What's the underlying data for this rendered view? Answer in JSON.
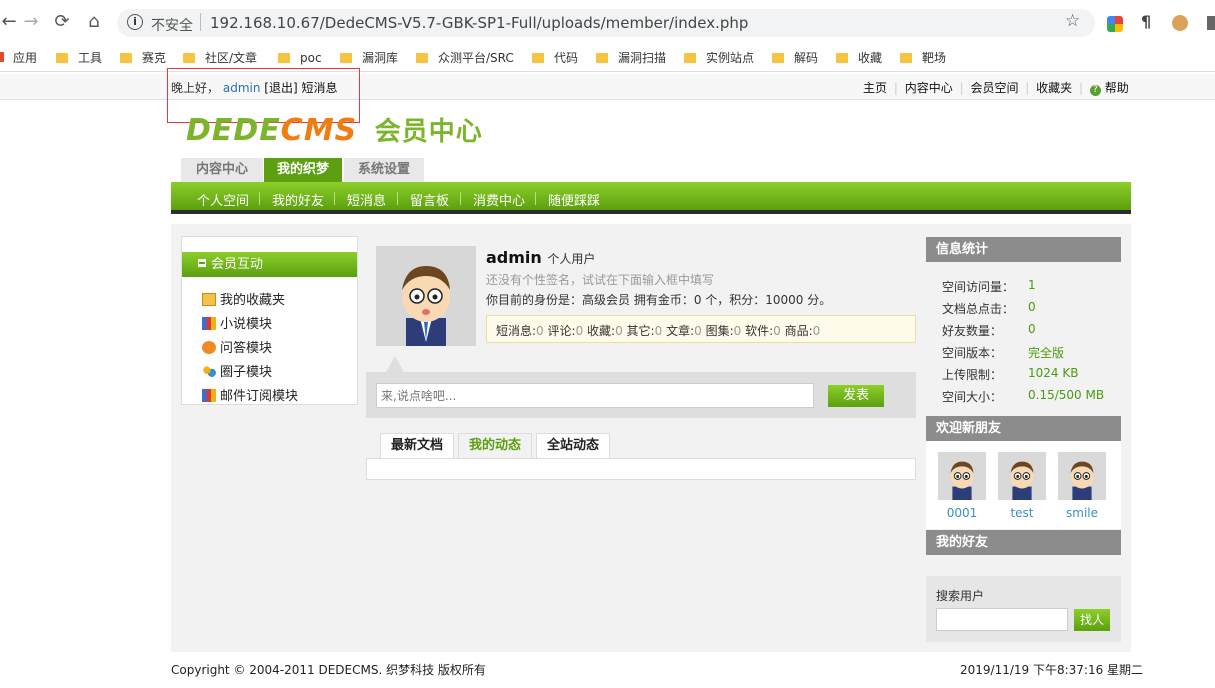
{
  "browser": {
    "security_label": "不安全",
    "url": "192.168.10.67/DedeCMS-V5.7-GBK-SP1-Full/uploads/member/index.php",
    "bookmarks": [
      "应用",
      "工具",
      "赛克",
      "社区/文章",
      "poc",
      "漏洞库",
      "众测平台/SRC",
      "代码",
      "漏洞扫描",
      "实例站点",
      "解码",
      "收藏",
      "靶场"
    ]
  },
  "topbar": {
    "greeting": "晚上好，",
    "username": "admin",
    "logout": "[退出]",
    "messages": "短消息",
    "links": [
      "主页",
      "内容中心",
      "会员空间",
      "收藏夹"
    ],
    "help": "帮助"
  },
  "logo": {
    "brand_a": "DEDE",
    "brand_b": "CMS",
    "subtitle": "会员中心"
  },
  "tabs": [
    "内容中心",
    "我的织梦",
    "系统设置"
  ],
  "active_tab": "我的织梦",
  "subnav": [
    "个人空间",
    "我的好友",
    "短消息",
    "留言板",
    "消费中心",
    "随便踩踩"
  ],
  "sidebar": {
    "title": "会员互动",
    "items": [
      "我的收藏夹",
      "小说模块",
      "问答模块",
      "圈子模块",
      "邮件订阅模块"
    ]
  },
  "profile": {
    "name": "admin",
    "type": "个人用户",
    "signature_hint": "还没有个性签名，试试在下面输入框中填写",
    "identity": "你目前的身份是：高级会员 拥有金币：0 个，积分：10000 分。",
    "counts": [
      {
        "label": "短消息:",
        "value": "0"
      },
      {
        "label": "评论:",
        "value": "0"
      },
      {
        "label": "收藏:",
        "value": "0"
      },
      {
        "label": "其它:",
        "value": "0"
      },
      {
        "label": "文章:",
        "value": "0"
      },
      {
        "label": "图集:",
        "value": "0"
      },
      {
        "label": "软件:",
        "value": "0"
      },
      {
        "label": "商品:",
        "value": "0"
      }
    ]
  },
  "post": {
    "placeholder": "来,说点啥吧...",
    "button": "发表"
  },
  "feed_tabs": [
    "最新文档",
    "我的动态",
    "全站动态"
  ],
  "stats": {
    "title": "信息统计",
    "rows": [
      {
        "k": "空间访问量：",
        "v": "1"
      },
      {
        "k": "文档总点击：",
        "v": "0"
      },
      {
        "k": "好友数量：",
        "v": "0"
      },
      {
        "k": "空间版本：",
        "v": "完全版"
      },
      {
        "k": "上传限制：",
        "v": "1024 KB"
      },
      {
        "k": "空间大小：",
        "v": "0.15/500 MB"
      }
    ]
  },
  "new_friends": {
    "title": "欢迎新朋友",
    "names": [
      "0001",
      "test",
      "smile"
    ]
  },
  "my_friends": {
    "title": "我的好友"
  },
  "search": {
    "label": "搜索用户",
    "button": "找人"
  },
  "footer": {
    "copyright": "Copyright © 2004-2011 DEDECMS. 织梦科技 版权所有",
    "datetime": "2019/11/19 下午8:37:16 星期二"
  }
}
